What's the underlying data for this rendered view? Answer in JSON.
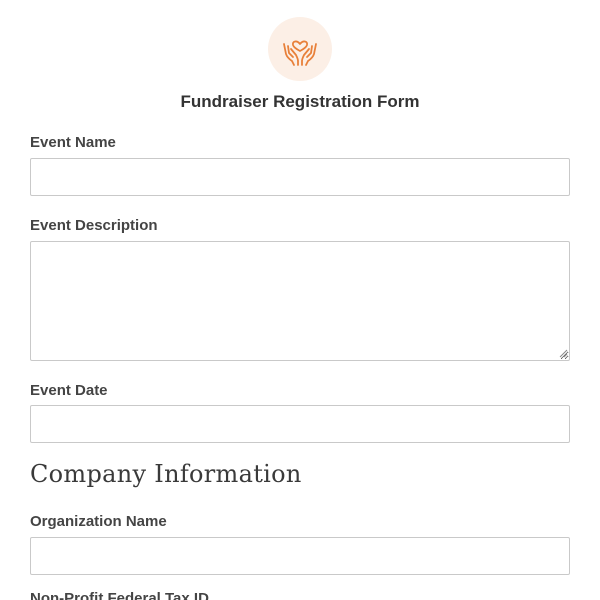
{
  "form": {
    "title": "Fundraiser Registration Form",
    "logo_icon": "heart-hands-icon",
    "accent_color": "#e8803a",
    "logo_bg_color": "#fcefe6"
  },
  "fields": {
    "event_name": {
      "label": "Event Name",
      "value": ""
    },
    "event_description": {
      "label": "Event Description",
      "value": ""
    },
    "event_date": {
      "label": "Event Date",
      "value": ""
    }
  },
  "company_section": {
    "heading": "Company Information",
    "organization_name": {
      "label": "Organization Name",
      "value": ""
    },
    "next_label_partial": "Non-Profit Federal Tax ID"
  }
}
